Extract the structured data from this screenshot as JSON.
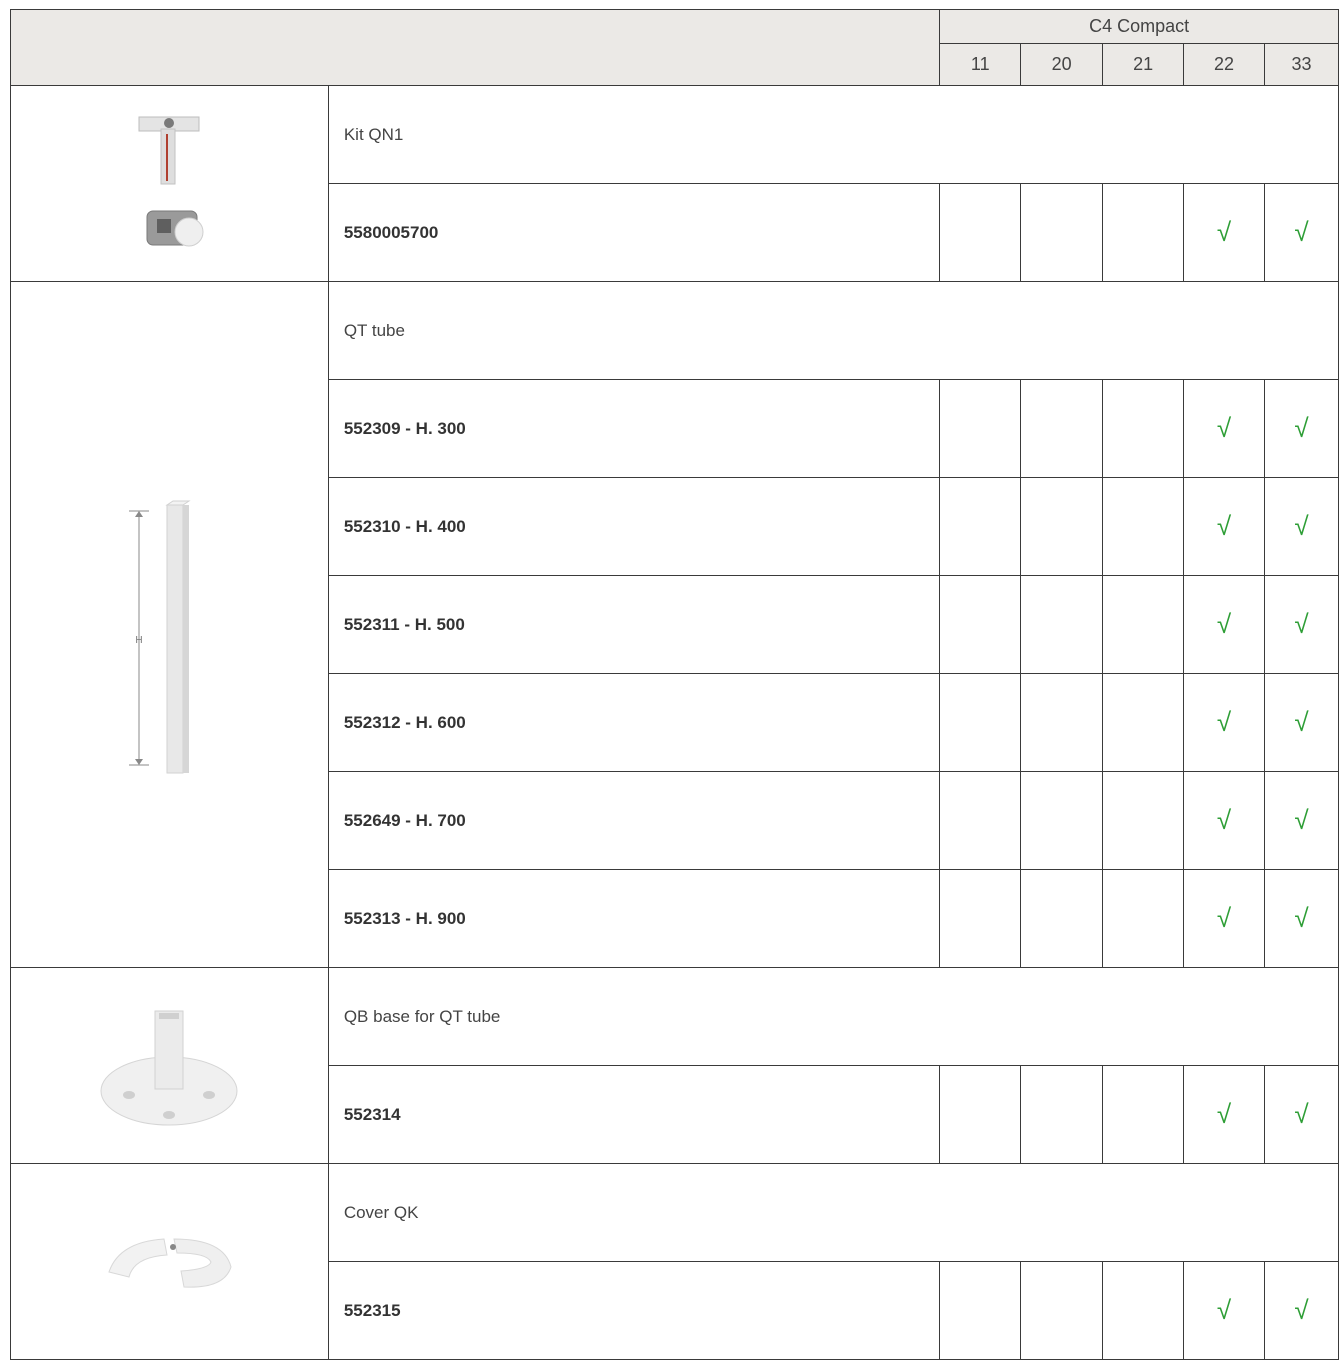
{
  "colors": {
    "header_bg": "#ebe9e6",
    "check": "#2e9e36",
    "border": "#3a3a3a"
  },
  "header": {
    "group_label": "C4 Compact",
    "columns": [
      "11",
      "20",
      "21",
      "22",
      "33"
    ]
  },
  "check_symbol": "√",
  "sections": [
    {
      "image_icon": "kit-qn1-bracket-image",
      "description": "Kit QN1",
      "rows": [
        {
          "code": "5580005700",
          "checks": [
            false,
            false,
            false,
            true,
            true
          ]
        }
      ]
    },
    {
      "image_icon": "qt-tube-image",
      "image_label": "H",
      "description": "QT tube",
      "rows": [
        {
          "code": "552309 - H. 300",
          "checks": [
            false,
            false,
            false,
            true,
            true
          ]
        },
        {
          "code": "552310 - H. 400",
          "checks": [
            false,
            false,
            false,
            true,
            true
          ]
        },
        {
          "code": "552311 - H. 500",
          "checks": [
            false,
            false,
            false,
            true,
            true
          ]
        },
        {
          "code": "552312 - H. 600",
          "checks": [
            false,
            false,
            false,
            true,
            true
          ]
        },
        {
          "code": "552649 - H. 700",
          "checks": [
            false,
            false,
            false,
            true,
            true
          ]
        },
        {
          "code": "552313 - H. 900",
          "checks": [
            false,
            false,
            false,
            true,
            true
          ]
        }
      ]
    },
    {
      "image_icon": "qb-base-image",
      "description": "QB base for QT tube",
      "rows": [
        {
          "code": "552314",
          "checks": [
            false,
            false,
            false,
            true,
            true
          ]
        }
      ]
    },
    {
      "image_icon": "cover-qk-image",
      "description": "Cover QK",
      "rows": [
        {
          "code": "552315",
          "checks": [
            false,
            false,
            false,
            true,
            true
          ]
        }
      ]
    }
  ]
}
